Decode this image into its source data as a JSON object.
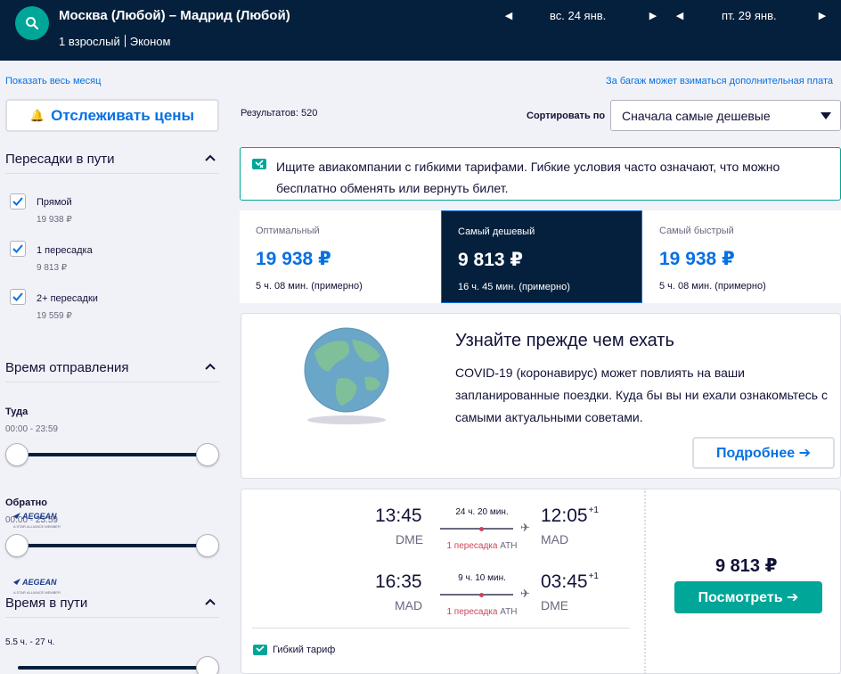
{
  "header": {
    "route": "Москва (Любой) – Мадрид (Любой)",
    "passengers": "1 взрослый",
    "cabin": "Эконом",
    "depart_date": "вс. 24 янв.",
    "return_date": "пт. 29 янв."
  },
  "links": {
    "show_month": "Показать весь месяц",
    "baggage_note": "За багаж может взиматься дополнительная плата"
  },
  "sidebar": {
    "track_prices": "Отслеживать цены",
    "stops": {
      "title": "Пересадки в пути",
      "options": [
        {
          "label": "Прямой",
          "price": "19 938 ₽",
          "checked": true
        },
        {
          "label": "1 пересадка",
          "price": "9 813 ₽",
          "checked": true
        },
        {
          "label": "2+ пересадки",
          "price": "19 559 ₽",
          "checked": true
        }
      ]
    },
    "departure_time": {
      "title": "Время отправления",
      "outbound_label": "Туда",
      "outbound_range": "00:00 - 23:59",
      "return_label": "Обратно",
      "return_range": "00:00 - 23:59"
    },
    "journey_time": {
      "title": "Время в пути",
      "range": "5.5 ч. - 27 ч."
    }
  },
  "results": {
    "count_text": "Результатов: 520",
    "sort_label": "Сортировать по",
    "sort_value": "Сначала самые дешевые"
  },
  "info_banner": {
    "text": "Ищите авиакомпании с гибкими тарифами. Гибкие условия часто означают, что можно бесплатно обменять или вернуть билет."
  },
  "tabs": [
    {
      "title": "Оптимальный",
      "price": "19 938 ₽",
      "duration": "5 ч. 08 мин. (примерно)"
    },
    {
      "title": "Самый дешевый",
      "price": "9 813 ₽",
      "duration": "16 ч. 45 мин. (примерно)"
    },
    {
      "title": "Самый быстрый",
      "price": "19 938 ₽",
      "duration": "5 ч. 08 мин. (примерно)"
    }
  ],
  "covid": {
    "title": "Узнайте прежде чем ехать",
    "text": "COVID-19 (коронавирус) может повлиять на ваши запланированные поездки. Куда бы вы ни ехали ознакомьтесь с самыми актуальными советами.",
    "button": "Подробнее ➔"
  },
  "flight": {
    "airline": "AEGEAN",
    "airline_sub": "A STAR ALLIANCE MEMBER",
    "outbound": {
      "dep_time": "13:45",
      "dep_code": "DME",
      "arr_time": "12:05",
      "arr_plus": "+1",
      "arr_code": "MAD",
      "duration": "24 ч. 20 мин.",
      "stops": "1 пересадка",
      "via": "ATH"
    },
    "inbound": {
      "dep_time": "16:35",
      "dep_code": "MAD",
      "arr_time": "03:45",
      "arr_plus": "+1",
      "arr_code": "DME",
      "duration": "9 ч. 10 мин.",
      "stops": "1 пересадка",
      "via": "ATH"
    },
    "flex_tag": "Гибкий тариф",
    "price": "9 813 ₽",
    "view_button": "Посмотреть ➔"
  }
}
